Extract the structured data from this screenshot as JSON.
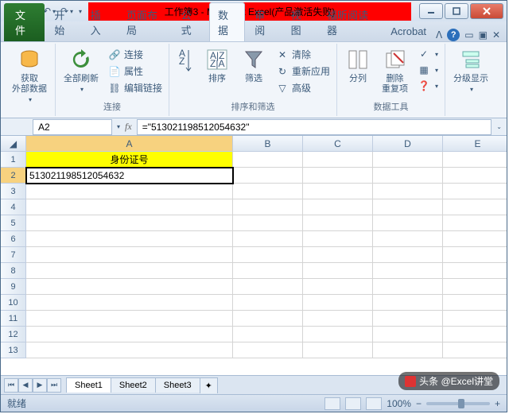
{
  "titlebar": {
    "title": "工作簿3 - Microsoft Excel(产品激活失败)"
  },
  "tabs": {
    "file": "文件",
    "items": [
      "开始",
      "插入",
      "页面布局",
      "公式",
      "数据",
      "审阅",
      "视图",
      "福昕阅读器",
      "Acrobat"
    ],
    "active_index": 4
  },
  "ribbon": {
    "g1": {
      "ext_data": "获取\n外部数据"
    },
    "g2": {
      "refresh": "全部刷新",
      "conn": "连接",
      "prop": "属性",
      "edit": "编辑链接",
      "label": "连接"
    },
    "g3": {
      "sort": "排序",
      "filter": "筛选",
      "clear": "清除",
      "reapply": "重新应用",
      "adv": "高级",
      "label": "排序和筛选"
    },
    "g4": {
      "ttc": "分列",
      "dup": "删除\n重复项",
      "label": "数据工具"
    },
    "g5": {
      "group": "分级显示"
    }
  },
  "namebox": {
    "ref": "A2"
  },
  "formula": {
    "value": "=\"513021198512054632\""
  },
  "columns": [
    "A",
    "B",
    "C",
    "D",
    "E"
  ],
  "cells": {
    "A1": "身份证号",
    "A2": "513021198512054632"
  },
  "sheets": [
    "Sheet1",
    "Sheet2",
    "Sheet3"
  ],
  "status": {
    "ready": "就绪",
    "zoom": "100%"
  },
  "watermark": "头条 @Excel讲堂"
}
